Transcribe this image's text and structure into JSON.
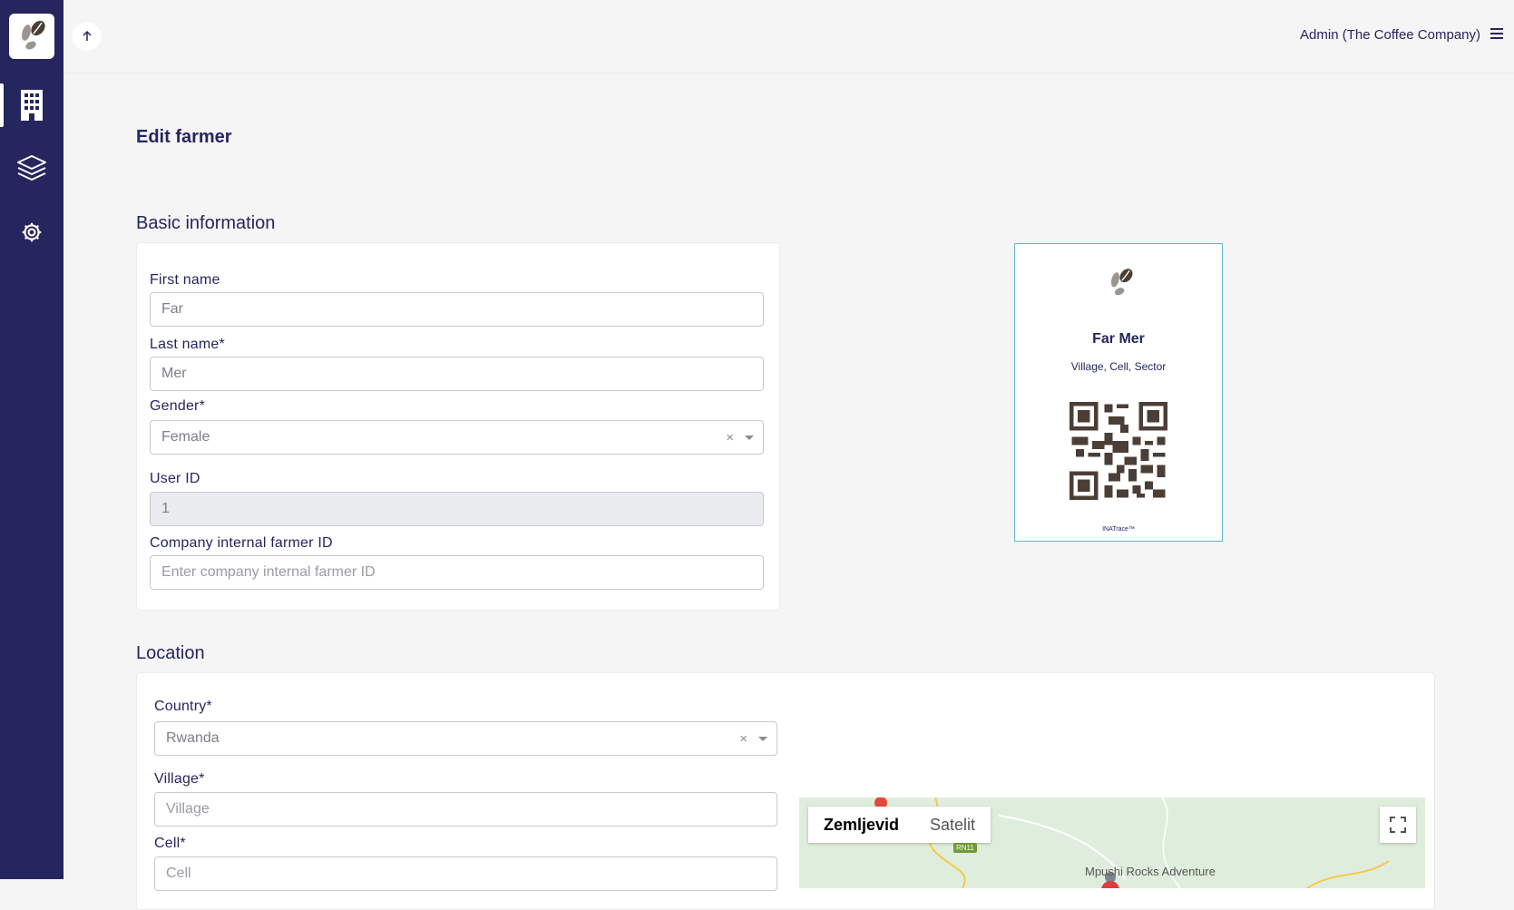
{
  "header": {
    "user": "Admin (The Coffee Company)"
  },
  "page": {
    "title": "Edit farmer"
  },
  "basic": {
    "section_title": "Basic information",
    "first_name_label": "First name",
    "first_name_value": "Far",
    "last_name_label": "Last name*",
    "last_name_value": "Mer",
    "gender_label": "Gender*",
    "gender_value": "Female",
    "user_id_label": "User ID",
    "user_id_value": "1",
    "internal_id_label": "Company internal farmer ID",
    "internal_id_placeholder": "Enter company internal farmer ID"
  },
  "farmer_card": {
    "name": "Far Mer",
    "address": "Village, Cell, Sector",
    "brand": "INATrace™"
  },
  "location": {
    "section_title": "Location",
    "country_label": "Country*",
    "country_value": "Rwanda",
    "village_label": "Village*",
    "village_placeholder": "Village",
    "cell_label": "Cell*",
    "cell_placeholder": "Cell"
  },
  "map": {
    "tab_map": "Zemljevid",
    "tab_satellite": "Satelit",
    "place_label": "Mpushi Rocks Adventure",
    "road_label": "RN11"
  },
  "icons": [
    "coffee-logo-icon",
    "building-icon",
    "layers-icon",
    "gear-icon",
    "arrow-up-icon",
    "hamburger-icon",
    "fullscreen-icon"
  ]
}
